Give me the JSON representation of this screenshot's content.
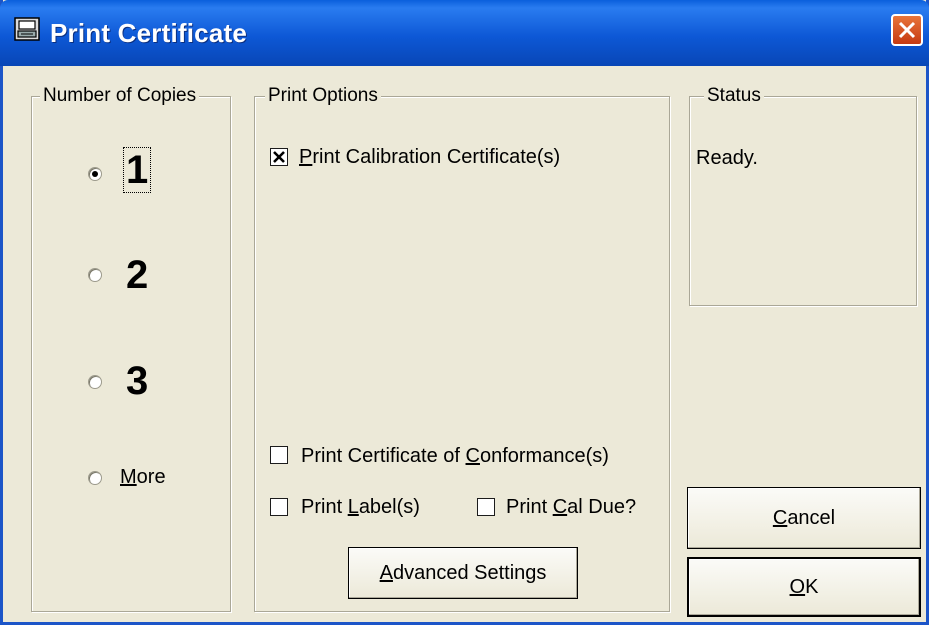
{
  "window": {
    "title": "Print Certificate"
  },
  "copies": {
    "legend": "Number of Copies",
    "options": [
      {
        "label": "1",
        "checked": true
      },
      {
        "label": "2",
        "checked": false
      },
      {
        "label": "3",
        "checked": false
      },
      {
        "label_prefix": "",
        "mnemonic": "M",
        "label_rest": "ore",
        "checked": false
      }
    ]
  },
  "print_options": {
    "legend": "Print Options",
    "calibration": {
      "prefix": "",
      "mnemonic": "P",
      "rest": "rint Calibration Certificate(s)",
      "checked": true
    },
    "conformance": {
      "prefix": "Print Certificate of ",
      "mnemonic": "C",
      "rest": "onformance(s)",
      "checked": false
    },
    "label": {
      "prefix": "Print ",
      "mnemonic": "L",
      "rest": "abel(s)",
      "checked": false
    },
    "cal_due": {
      "prefix": "Print ",
      "mnemonic": "C",
      "rest": "al Due?",
      "checked": false
    },
    "advanced": {
      "prefix": "",
      "mnemonic": "A",
      "rest": "dvanced Settings"
    }
  },
  "status": {
    "legend": "Status",
    "text": "Ready."
  },
  "buttons": {
    "cancel": {
      "mnemonic": "C",
      "rest": "ancel"
    },
    "ok": {
      "mnemonic": "O",
      "rest": "K"
    }
  }
}
